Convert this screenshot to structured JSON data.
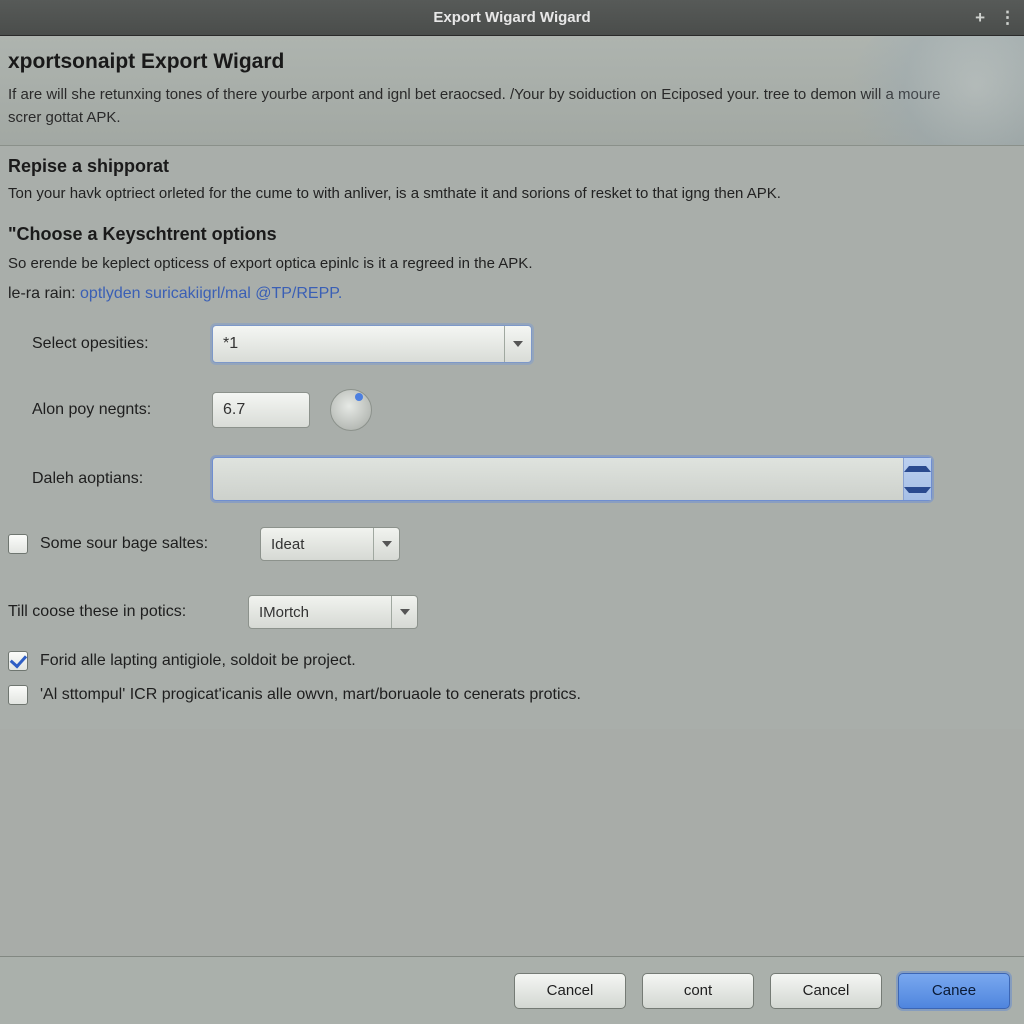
{
  "titlebar": {
    "title": "Export Wigard Wigard",
    "plus_icon": "+",
    "menu_icon": "⋮"
  },
  "header": {
    "title": "xportsonaipt Export Wigard",
    "desc": "If are will she retunxing tones of there yourbe arpont and ignl bet eraocsed. /Your by soiduction on Eciposed your. tree to demon will a moure screr gottat APK."
  },
  "section1": {
    "title": "Repise a shipporat",
    "desc": "Ton your havk optriect orleted for the cume to with anliver, is a smthate it and sorions of resket to that igng then APK."
  },
  "section2": {
    "title": "\"Choose a Keyschtrent options",
    "desc": "So erende be keplect opticess of export optica epinlc is it a regreed in the APK.",
    "link_prefix": "le-ra rain: ",
    "link_text": "optlyden suricakiigrl/mal @TP/REPP."
  },
  "form": {
    "select_label": "Select opesities:",
    "select_value": "*1",
    "alon_label": "Alon poy negnts:",
    "alon_value": "6.7",
    "daleh_label": "Daleh aoptians:",
    "daleh_value": "",
    "some_label": "Some sour bage saltes:",
    "some_value": "Ideat",
    "till_label": "Till coose these in potics:",
    "till_value": "IMortch",
    "check1_label": "Forid alle lapting antigiole, soldoit be project.",
    "check2_label": "'Al sttompul' ICR progicat'icanis alle owvn, mart/boruaole to cenerats protics."
  },
  "footer": {
    "btn1": "Cancel",
    "btn2": "cont",
    "btn3": "Cancel",
    "btn4": "Canee"
  }
}
